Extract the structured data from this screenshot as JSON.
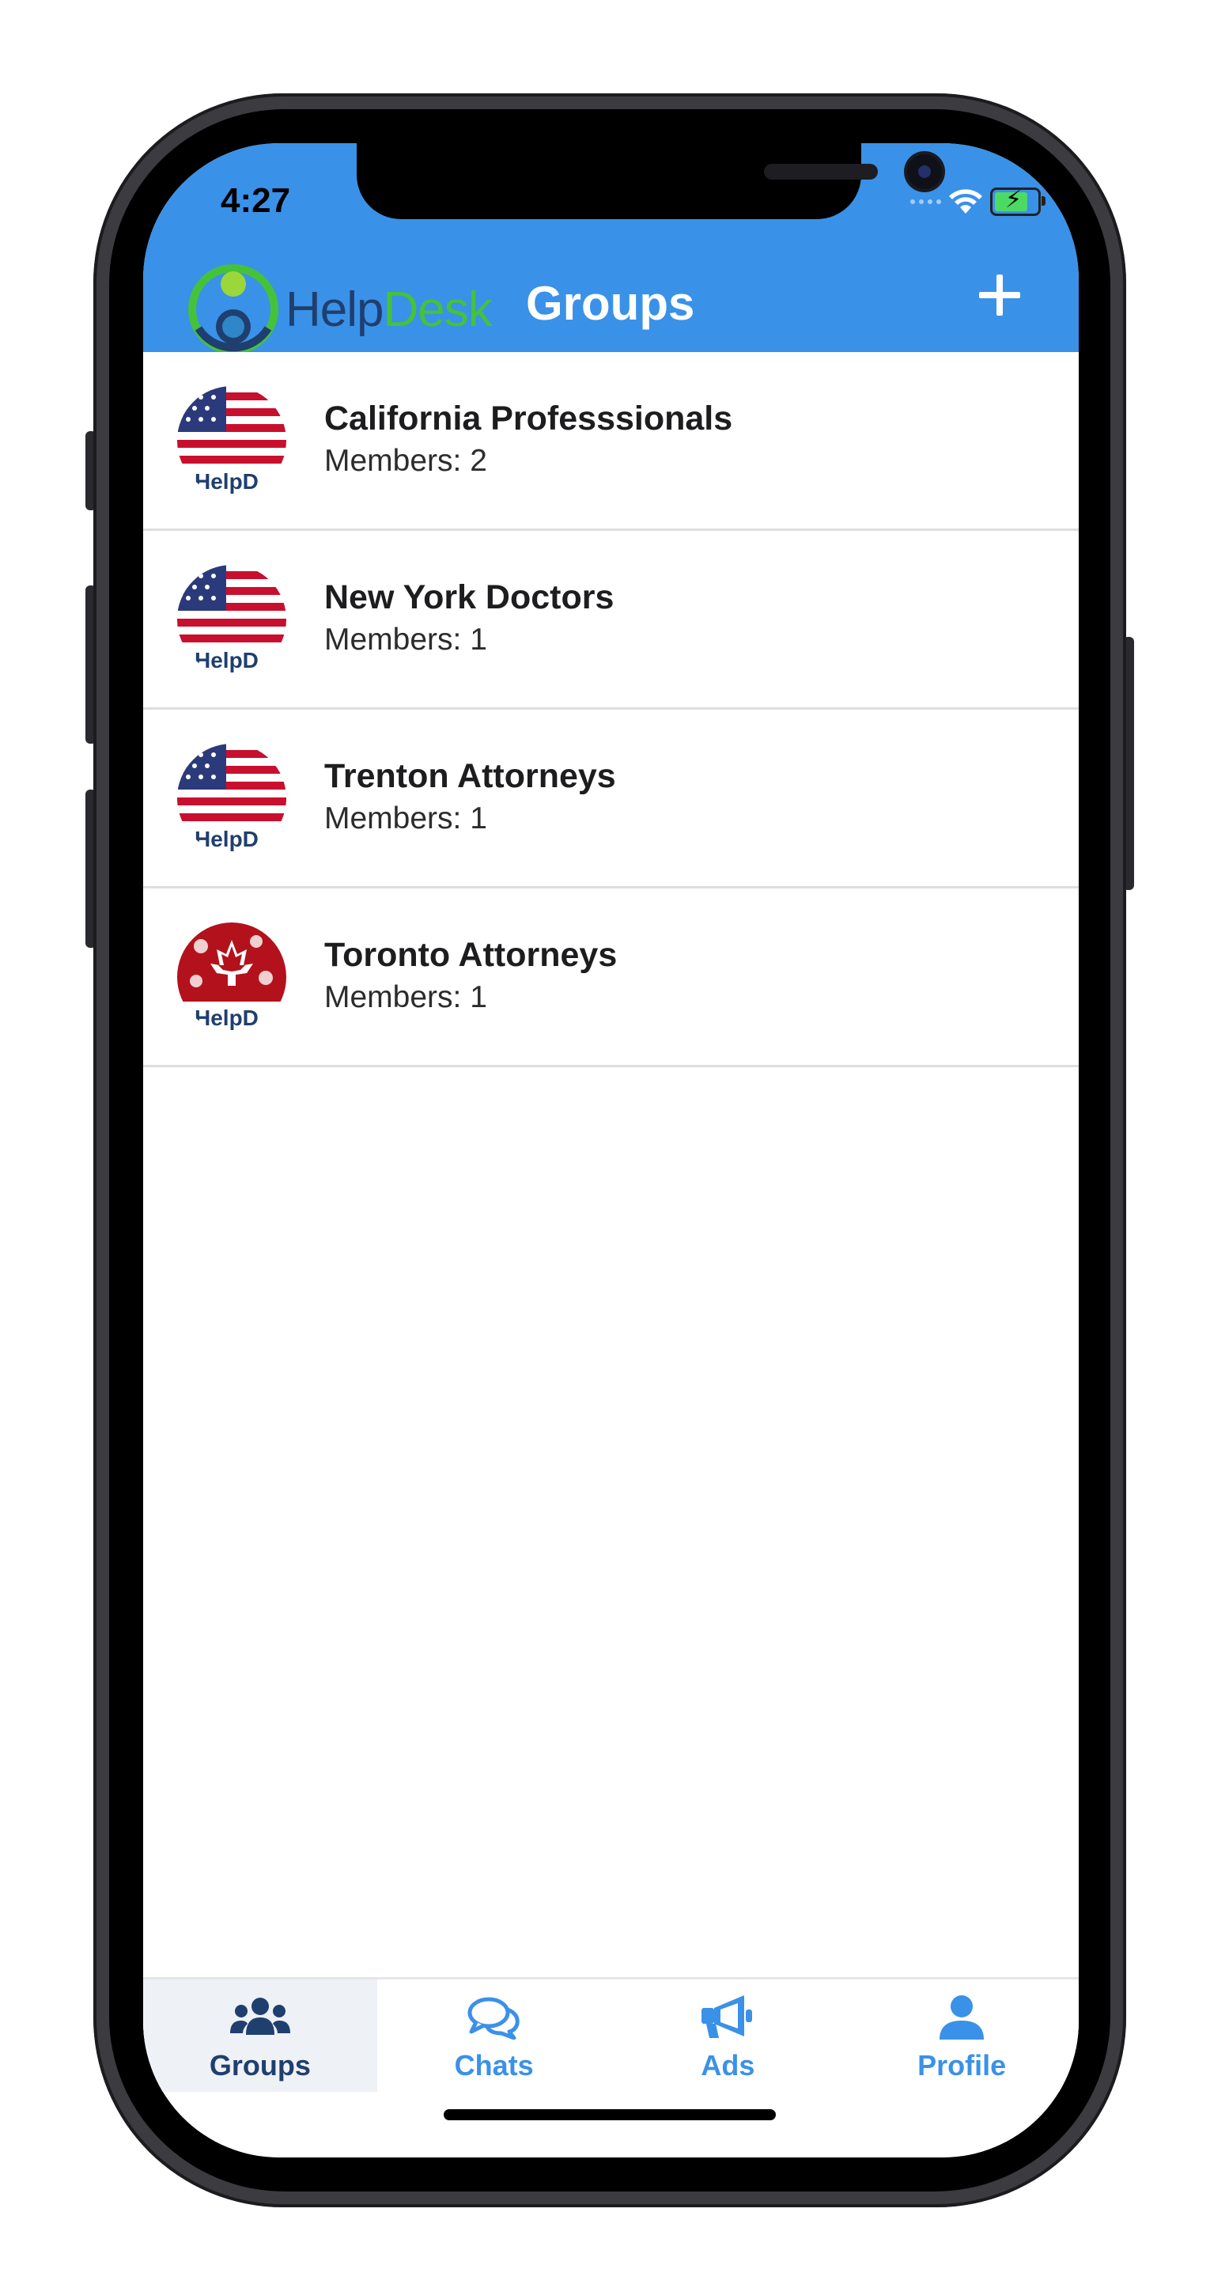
{
  "status_bar": {
    "time": "4:27"
  },
  "header": {
    "logo": {
      "part1": "Help",
      "part2": "Desk"
    },
    "title": "Groups",
    "add_icon": "plus-icon"
  },
  "groups": [
    {
      "name": "California Professsionals",
      "members": "Members: 2",
      "flag": "usa-flag",
      "badge": "HelpD"
    },
    {
      "name": "New York Doctors",
      "members": "Members: 1",
      "flag": "usa-flag",
      "badge": "HelpD"
    },
    {
      "name": "Trenton Attorneys",
      "members": "Members: 1",
      "flag": "usa-flag",
      "badge": "HelpD"
    },
    {
      "name": "Toronto Attorneys",
      "members": "Members: 1",
      "flag": "canada-flag",
      "badge": "HelpD"
    }
  ],
  "tabs": [
    {
      "label": "Groups",
      "icon": "users-icon",
      "active": true
    },
    {
      "label": "Chats",
      "icon": "chat-bubbles-icon",
      "active": false
    },
    {
      "label": "Ads",
      "icon": "megaphone-icon",
      "active": false
    },
    {
      "label": "Profile",
      "icon": "user-icon",
      "active": false
    }
  ],
  "colors": {
    "header_bg": "#3a91e8",
    "tab_accent": "#3a91e8",
    "tab_active_text": "#1f3f6e",
    "logo_green": "#46c23a",
    "logo_navy": "#1f3f6e"
  }
}
